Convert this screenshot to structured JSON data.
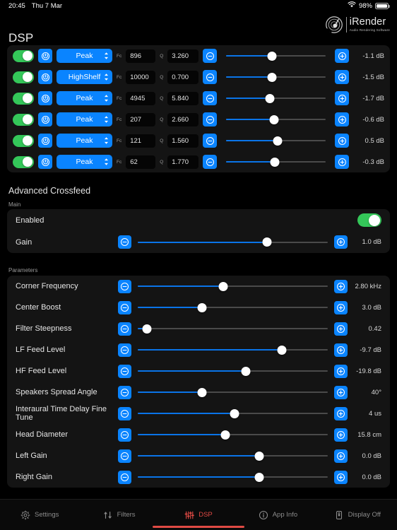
{
  "statusbar": {
    "time": "20:45",
    "date": "Thu 7 Mar",
    "battery_pct": "98%",
    "wifi_icon": "wifi-icon",
    "battery_icon": "battery-icon"
  },
  "brand": {
    "name": "iRender",
    "tagline": "Audio Rendering Software",
    "logo_icon": "irender-logo-icon"
  },
  "page": {
    "title": "DSP"
  },
  "colors": {
    "accent_blue": "#0a84ff",
    "track_blue": "#0a74e8",
    "toggle_green": "#34c759",
    "tab_active_red": "#e04a44",
    "panel_bg": "#141414",
    "page_bg": "#000000"
  },
  "filters": {
    "fc_label": "Fc",
    "q_label": "Q",
    "rows": [
      {
        "enabled": true,
        "type": "Peak",
        "fc": "896",
        "q": "3.260",
        "gain": "-1.1 dB",
        "slider_pct": 46
      },
      {
        "enabled": true,
        "type": "HighShelf",
        "fc": "10000",
        "q": "0.700",
        "gain": "-1.5 dB",
        "slider_pct": 46
      },
      {
        "enabled": true,
        "type": "Peak",
        "fc": "4945",
        "q": "5.840",
        "gain": "-1.7 dB",
        "slider_pct": 44
      },
      {
        "enabled": true,
        "type": "Peak",
        "fc": "207",
        "q": "2.660",
        "gain": "-0.6 dB",
        "slider_pct": 48
      },
      {
        "enabled": true,
        "type": "Peak",
        "fc": "121",
        "q": "1.560",
        "gain": "0.5 dB",
        "slider_pct": 52
      },
      {
        "enabled": true,
        "type": "Peak",
        "fc": "62",
        "q": "1.770",
        "gain": "-0.3 dB",
        "slider_pct": 49
      }
    ]
  },
  "crossfeed": {
    "section_title": "Advanced Crossfeed",
    "main_subtitle": "Main",
    "enabled_label": "Enabled",
    "enabled_value": true,
    "gain_label": "Gain",
    "gain_value": "1.0 dB",
    "gain_pct": 68,
    "params_subtitle": "Parameters",
    "params": [
      {
        "label": "Corner Frequency",
        "value": "2.80 kHz",
        "pct": 45
      },
      {
        "label": "Center Boost",
        "value": "3.0 dB",
        "pct": 34
      },
      {
        "label": "Filter Steepness",
        "value": "0.42",
        "pct": 5
      },
      {
        "label": "LF Feed Level",
        "value": "-9.7 dB",
        "pct": 76
      },
      {
        "label": "HF Feed Level",
        "value": "-19.8 dB",
        "pct": 57
      },
      {
        "label": "Speakers Spread Angle",
        "value": "40°",
        "pct": 34
      },
      {
        "label": "Interaural Time Delay Fine Tune",
        "value": "4 us",
        "pct": 51
      },
      {
        "label": "Head Diameter",
        "value": "15.8 cm",
        "pct": 46
      },
      {
        "label": "Left Gain",
        "value": "0.0 dB",
        "pct": 64
      },
      {
        "label": "Right Gain",
        "value": "0.0 dB",
        "pct": 64
      }
    ]
  },
  "tabbar": {
    "tabs": [
      {
        "label": "Settings",
        "icon": "gear-icon",
        "active": false
      },
      {
        "label": "Filters",
        "icon": "filters-icon",
        "active": false
      },
      {
        "label": "DSP",
        "icon": "sliders-icon",
        "active": true
      },
      {
        "label": "App Info",
        "icon": "info-icon",
        "active": false
      },
      {
        "label": "Display Off",
        "icon": "display-off-icon",
        "active": false
      }
    ]
  }
}
